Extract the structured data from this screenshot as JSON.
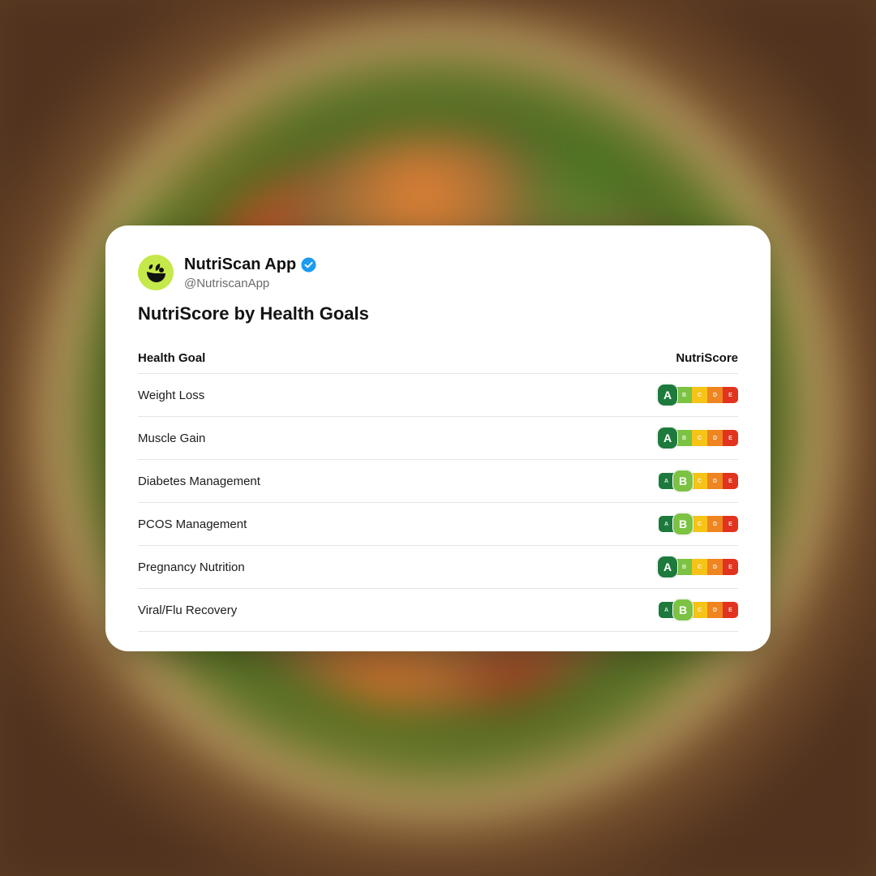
{
  "app": {
    "name": "NutriScan App",
    "handle": "@NutriscanApp",
    "avatar_icon": "leaf-plate-logo",
    "avatar_color": "#c5e84a",
    "verified_color": "#1d9bf0"
  },
  "title": "NutriScore by Health Goals",
  "table": {
    "headers": {
      "goal": "Health Goal",
      "score": "NutriScore"
    },
    "scale": {
      "letters": [
        "A",
        "B",
        "C",
        "D",
        "E"
      ],
      "colors": [
        "#1e7a3c",
        "#7cc243",
        "#f6c317",
        "#ee8520",
        "#e2331f"
      ]
    },
    "rows": [
      {
        "goal": "Weight Loss",
        "score": "A"
      },
      {
        "goal": "Muscle Gain",
        "score": "A"
      },
      {
        "goal": "Diabetes Management",
        "score": "B"
      },
      {
        "goal": "PCOS Management",
        "score": "B"
      },
      {
        "goal": "Pregnancy Nutrition",
        "score": "A"
      },
      {
        "goal": "Viral/Flu Recovery",
        "score": "B"
      }
    ]
  }
}
